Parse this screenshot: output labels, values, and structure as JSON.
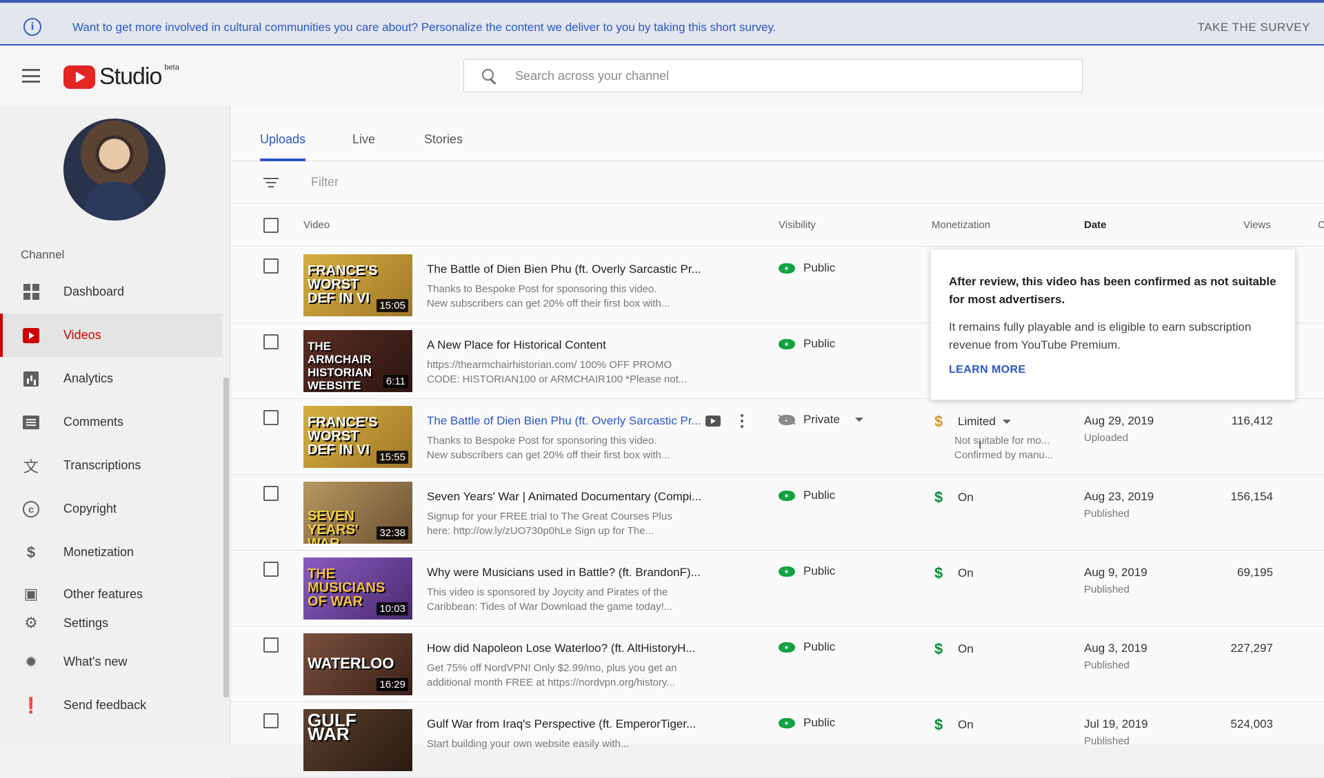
{
  "banner": {
    "message": "Want to get more involved in cultural communities you care about? Personalize the content we deliver to you by taking this short survey.",
    "cta": "TAKE THE SURVEY",
    "info_glyph": "i"
  },
  "header": {
    "logo_word": "Studio",
    "logo_badge": "beta",
    "search_placeholder": "Search across your channel"
  },
  "sidebar": {
    "channel_label": "Channel",
    "items": [
      {
        "label": "Dashboard",
        "icon": "dashboard-icon"
      },
      {
        "label": "Videos",
        "icon": "videos-icon",
        "active": true
      },
      {
        "label": "Analytics",
        "icon": "analytics-icon"
      },
      {
        "label": "Comments",
        "icon": "comments-icon"
      },
      {
        "label": "Transcriptions",
        "icon": "translate-icon"
      },
      {
        "label": "Copyright",
        "icon": "copyright-icon"
      },
      {
        "label": "Monetization",
        "icon": "dollar-icon"
      },
      {
        "label": "Other features",
        "icon": "other-features-icon"
      },
      {
        "label": "Settings",
        "icon": "gear-icon"
      },
      {
        "label": "What's new",
        "icon": "badge-icon"
      },
      {
        "label": "Send feedback",
        "icon": "feedback-icon"
      }
    ]
  },
  "tabs": [
    {
      "label": "Uploads",
      "active": true
    },
    {
      "label": "Live"
    },
    {
      "label": "Stories"
    }
  ],
  "filter": {
    "placeholder": "Filter"
  },
  "table": {
    "headers": {
      "video": "Video",
      "visibility": "Visibility",
      "monetization": "Monetization",
      "date": "Date",
      "views": "Views",
      "comments_clip": "C"
    },
    "rows": [
      {
        "thumb_text": "France's Worst Def in Vi",
        "thumb_color": "#c8a040",
        "duration": "15:05",
        "title": "The Battle of Dien Bien Phu (ft. Overly Sarcastic Pr...",
        "desc1": "Thanks to Bespoke Post for sponsoring this video.",
        "desc2": "New subscribers can get 20% off their first box with...",
        "visibility": "Public"
      },
      {
        "thumb_text": "The Armchair Historian Website",
        "thumb_color": "#4a2a22",
        "duration": "6:11",
        "title": "A New Place for Historical Content",
        "desc1": "https://thearmchairhistorian.com/ 100% OFF PROMO",
        "desc2": "CODE: HISTORIAN100 or ARMCHAIR100 *Please not...",
        "visibility": "Public"
      },
      {
        "thumb_text": "France's Worst Def in Vi",
        "thumb_color": "#c8a040",
        "duration": "15:55",
        "title": "The Battle of Dien Bien Phu (ft. Overly Sarcastic Pr...",
        "desc1": "Thanks to Bespoke Post for sponsoring this video.",
        "desc2": "New subscribers can get 20% off their first box with...",
        "visibility": "Private",
        "monetization": "Limited",
        "mon_sub1": "Not suitable for mo...",
        "mon_sub2": "Confirmed by manu...",
        "date": "Aug 29, 2019",
        "date_status": "Uploaded",
        "views": "116,412"
      },
      {
        "thumb_text": "Seven Years' War",
        "thumb_color": "#8a6a3a",
        "duration": "32:38",
        "title": "Seven Years' War | Animated Documentary (Compi...",
        "desc1": "Signup for your FREE trial to The Great Courses Plus",
        "desc2": "here: http://ow.ly/zUO730p0hLe Sign up for The...",
        "visibility": "Public",
        "monetization": "On",
        "date": "Aug 23, 2019",
        "date_status": "Published",
        "views": "156,154"
      },
      {
        "thumb_text": "The Musicians of War",
        "thumb_color": "#7a4aa8",
        "duration": "10:03",
        "title": "Why were Musicians used in Battle? (ft. BrandonF)...",
        "desc1": "This video is sponsored by Joycity and Pirates of the",
        "desc2": "Caribbean: Tides of War Download the game today!...",
        "visibility": "Public",
        "monetization": "On",
        "date": "Aug 9, 2019",
        "date_status": "Published",
        "views": "69,195"
      },
      {
        "thumb_text": "Waterloo",
        "thumb_color": "#6a4a3a",
        "duration": "16:29",
        "title": "How did Napoleon Lose Waterloo? (ft. AltHistoryH...",
        "desc1": "Get 75% off NordVPN! Only $2.99/mo, plus you get an",
        "desc2": "additional month FREE at https://nordvpn.org/history...",
        "visibility": "Public",
        "monetization": "On",
        "date": "Aug 3, 2019",
        "date_status": "Published",
        "views": "227,297"
      },
      {
        "thumb_text": "Gulf War",
        "thumb_color": "#4a3a2a",
        "duration": "",
        "title": "Gulf War from Iraq's Perspective (ft. EmperorTiger...",
        "desc1": "Start building your own website easily with...",
        "desc2": "",
        "visibility": "Public",
        "monetization": "On",
        "date": "Jul 19, 2019",
        "date_status": "Published",
        "views": "524,003"
      }
    ]
  },
  "tooltip": {
    "headline": "After review, this video has been confirmed as not suitable for most advertisers.",
    "body": "It remains fully playable and is eligible to earn subscription revenue from YouTube Premium.",
    "link": "LEARN MORE"
  },
  "colors": {
    "accent": "#2a56c6",
    "brand_red": "#cc0000",
    "public_green": "#10a240",
    "limited_gold": "#d89a2a"
  }
}
